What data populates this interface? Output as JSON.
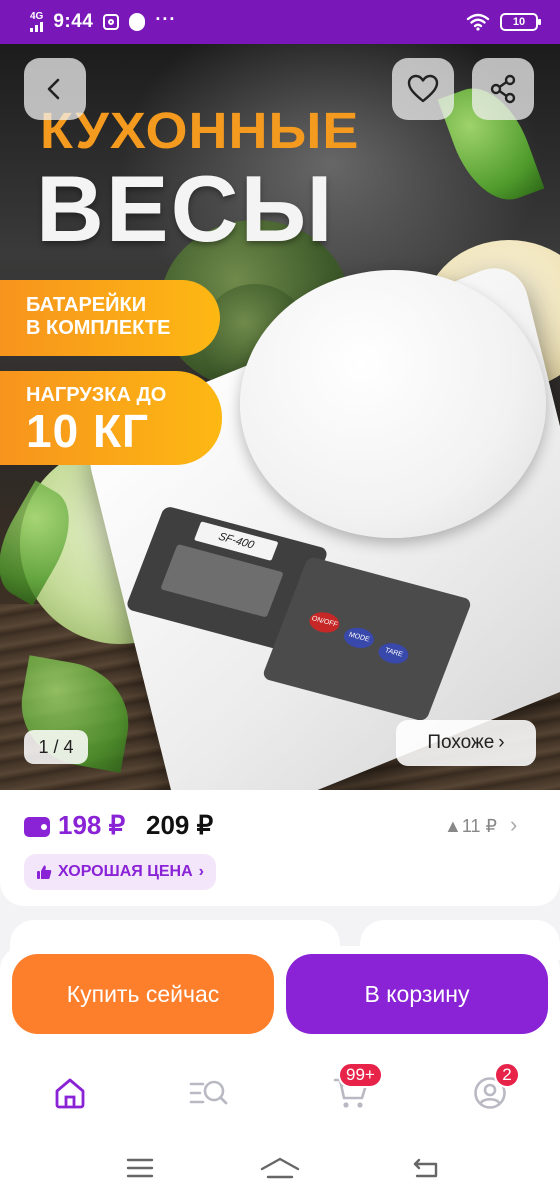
{
  "status_bar": {
    "network": "4G",
    "time": "9:44",
    "battery": "10",
    "dots": "···"
  },
  "hero": {
    "title_line1": "КУХОННЫЕ",
    "title_line2": "ВЕСЫ",
    "badge1_line1": "БАТАРЕЙКИ",
    "badge1_line2": "В КОМПЛЕКТЕ",
    "badge2_line1": "НАГРУЗКА ДО",
    "badge2_line2": "10 КГ",
    "scale_model": "SF-400",
    "key_onoff": "ON/OFF",
    "key_mode": "MODE",
    "key_tare": "TARE",
    "image_counter": "1 / 4",
    "similar_label": "Похоже",
    "similar_chevron": "›",
    "back_icon": "chevron-left-icon",
    "favorite_icon": "heart-icon",
    "share_icon": "share-icon"
  },
  "price": {
    "wallet_price": "198 ₽",
    "regular_price": "209 ₽",
    "diff": "▲11 ₽",
    "chevron": "›",
    "good_price_label": "ХОРОШАЯ ЦЕНА",
    "good_price_chevron": "›"
  },
  "actions": {
    "buy_now": "Купить сейчас",
    "add_to_cart": "В корзину"
  },
  "bottom_nav": {
    "items": [
      {
        "icon": "home-icon",
        "active": true
      },
      {
        "icon": "catalog-search-icon",
        "active": false
      },
      {
        "icon": "cart-icon",
        "badge": "99+"
      },
      {
        "icon": "profile-icon",
        "badge": "2"
      }
    ]
  },
  "colors": {
    "brand_purple": "#8a22d6",
    "status_bar": "#7a17b8",
    "buy_orange": "#fd7f2c",
    "badge_red": "#e8234a"
  }
}
